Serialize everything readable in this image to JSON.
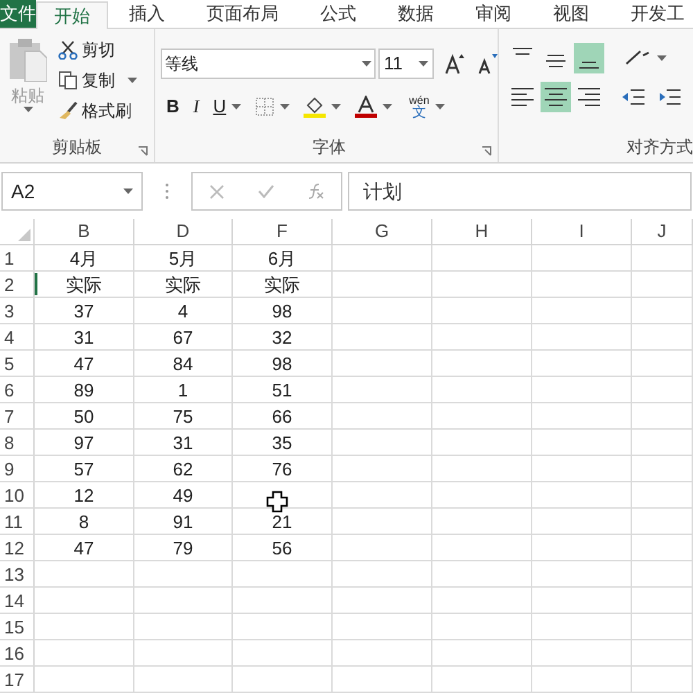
{
  "tabs": [
    {
      "label": "文件",
      "kind": "file",
      "selected": false
    },
    {
      "label": "开始",
      "selected": true
    },
    {
      "label": "插入",
      "selected": false
    },
    {
      "label": "页面布局",
      "selected": false
    },
    {
      "label": "公式",
      "selected": false
    },
    {
      "label": "数据",
      "selected": false
    },
    {
      "label": "审阅",
      "selected": false
    },
    {
      "label": "视图",
      "selected": false
    },
    {
      "label": "开发工",
      "selected": false
    }
  ],
  "clipboard": {
    "paste": "粘贴",
    "cut": "剪切",
    "copy": "复制",
    "format_painter": "格式刷",
    "label": "剪贴板"
  },
  "font": {
    "name": "等线",
    "size": "11",
    "bold": "B",
    "italic": "I",
    "underline": "U",
    "phonetic_top": "wén",
    "phonetic_bottom": "文",
    "label": "字体"
  },
  "alignment": {
    "vertical": [
      {
        "kind": "top",
        "selected": false
      },
      {
        "kind": "middle",
        "selected": false
      },
      {
        "kind": "bottom",
        "selected": true
      }
    ],
    "horizontal": [
      {
        "kind": "left",
        "selected": false
      },
      {
        "kind": "center",
        "selected": true
      },
      {
        "kind": "right",
        "selected": false
      }
    ],
    "label": "对齐方式"
  },
  "formula_bar": {
    "name_box": "A2",
    "value": "计划"
  },
  "columns": [
    "B",
    "D",
    "F",
    "G",
    "H",
    "I",
    "J"
  ],
  "rows": [
    {
      "number": "1",
      "cells": [
        "4月",
        "5月",
        "6月"
      ]
    },
    {
      "number": "2",
      "cells": [
        "实际",
        "实际",
        "实际"
      ]
    },
    {
      "number": "3",
      "cells": [
        "37",
        "4",
        "98"
      ]
    },
    {
      "number": "4",
      "cells": [
        "31",
        "67",
        "32"
      ]
    },
    {
      "number": "5",
      "cells": [
        "47",
        "84",
        "98"
      ]
    },
    {
      "number": "6",
      "cells": [
        "89",
        "1",
        "51"
      ]
    },
    {
      "number": "7",
      "cells": [
        "50",
        "75",
        "66"
      ]
    },
    {
      "number": "8",
      "cells": [
        "97",
        "31",
        "35"
      ]
    },
    {
      "number": "9",
      "cells": [
        "57",
        "62",
        "76"
      ]
    },
    {
      "number": "10",
      "cells": [
        "12",
        "49",
        null
      ]
    },
    {
      "number": "11",
      "cells": [
        "8",
        "91",
        "21"
      ]
    },
    {
      "number": "12",
      "cells": [
        "47",
        "79",
        "56"
      ]
    },
    {
      "number": "13",
      "cells": []
    },
    {
      "number": "14",
      "cells": []
    },
    {
      "number": "15",
      "cells": []
    },
    {
      "number": "16",
      "cells": []
    },
    {
      "number": "17",
      "cells": []
    }
  ]
}
